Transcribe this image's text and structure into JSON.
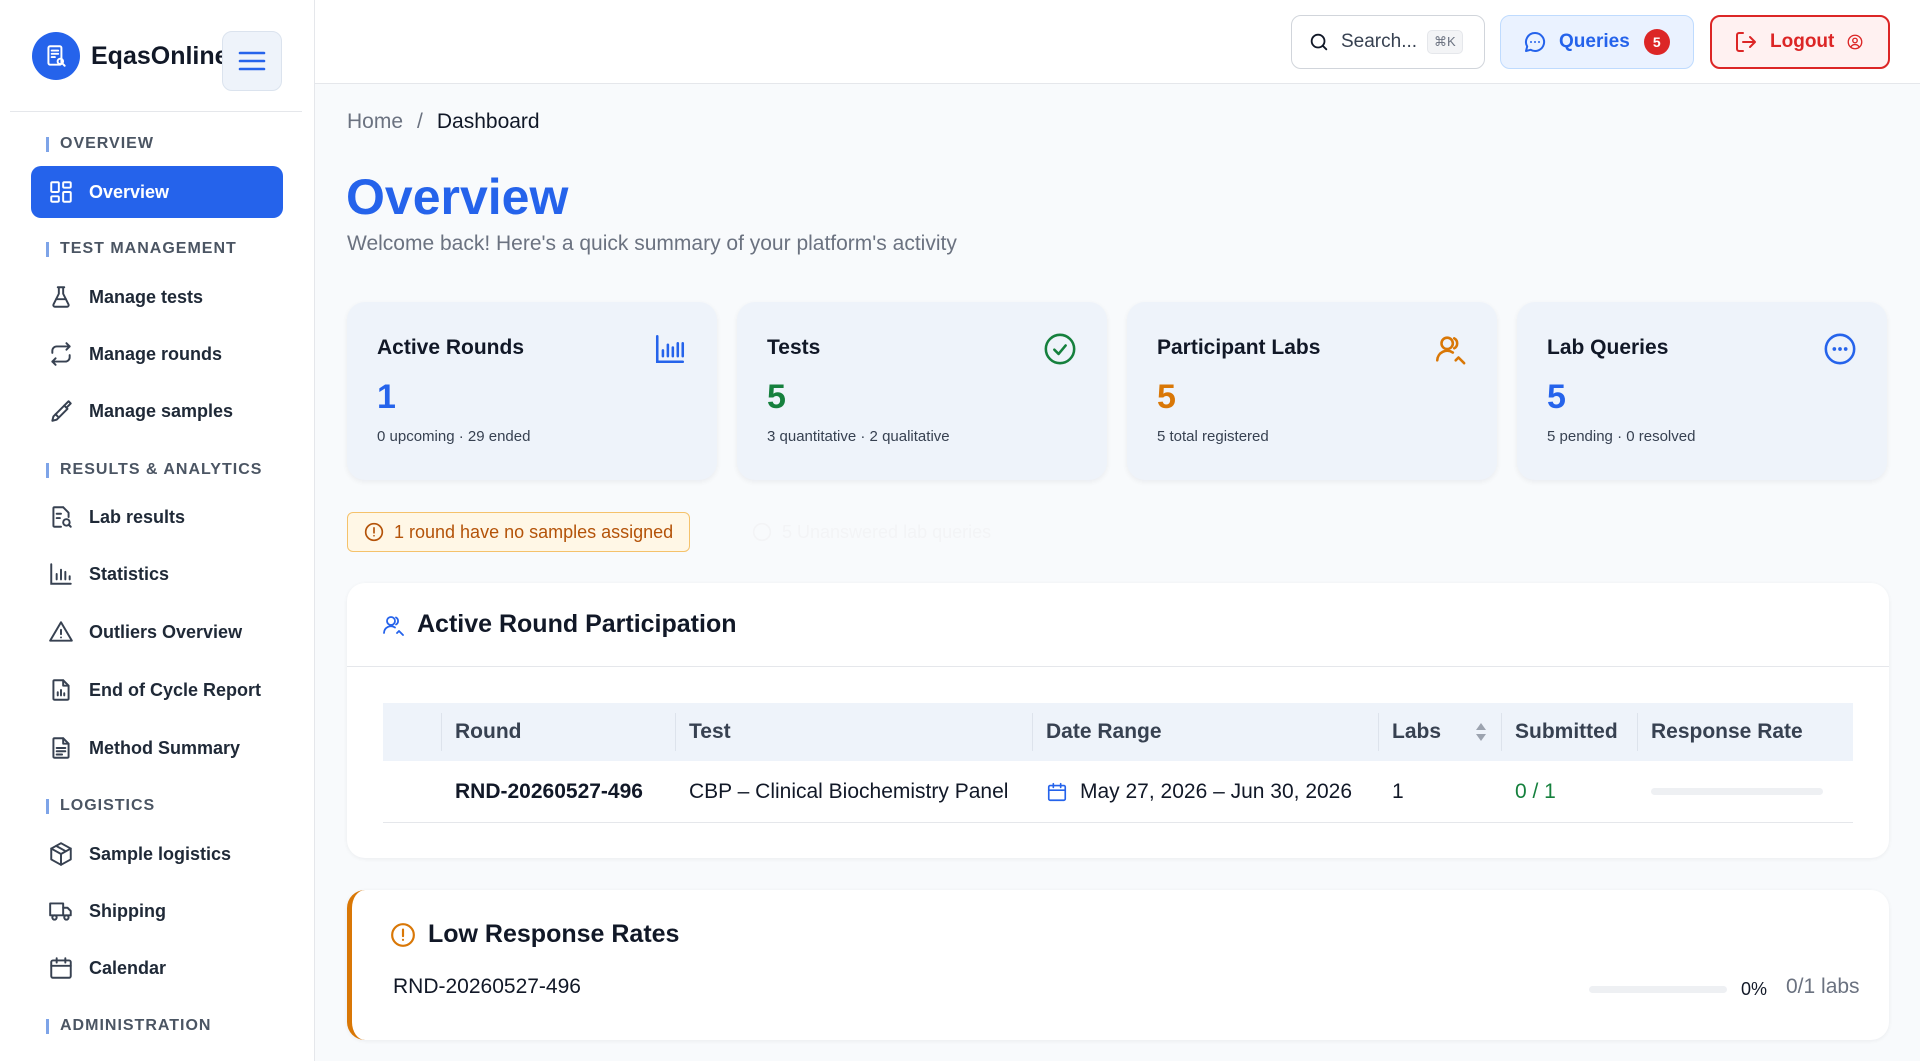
{
  "app": {
    "name": "EqasOnline"
  },
  "sidebar": {
    "sections": [
      {
        "label": "OVERVIEW"
      },
      {
        "label": "TEST MANAGEMENT"
      },
      {
        "label": "RESULTS & ANALYTICS"
      },
      {
        "label": "LOGISTICS"
      },
      {
        "label": "ADMINISTRATION"
      }
    ],
    "items": [
      {
        "label": "Overview",
        "icon": "grid-icon",
        "active": true
      },
      {
        "label": "Manage tests",
        "icon": "flask-icon"
      },
      {
        "label": "Manage rounds",
        "icon": "repeat-icon"
      },
      {
        "label": "Manage samples",
        "icon": "pipette-icon"
      },
      {
        "label": "Lab results",
        "icon": "file-chart-icon"
      },
      {
        "label": "Statistics",
        "icon": "bar-chart-icon"
      },
      {
        "label": "Outliers Overview",
        "icon": "warning-triangle-icon"
      },
      {
        "label": "End of Cycle Report",
        "icon": "report-icon"
      },
      {
        "label": "Method Summary",
        "icon": "document-icon"
      },
      {
        "label": "Sample logistics",
        "icon": "package-icon"
      },
      {
        "label": "Shipping",
        "icon": "truck-icon"
      },
      {
        "label": "Calendar",
        "icon": "calendar-icon"
      }
    ]
  },
  "topbar": {
    "search_label": "Search...",
    "search_shortcut": "⌘K",
    "queries_label": "Queries",
    "queries_count": "5",
    "logout_label": "Logout"
  },
  "breadcrumb": {
    "home": "Home",
    "separator": "/",
    "current": "Dashboard"
  },
  "page": {
    "title": "Overview",
    "subtitle": "Welcome back! Here's a quick summary of your platform's activity"
  },
  "stats": [
    {
      "title": "Active Rounds",
      "value": "1",
      "sub": "0 upcoming · 29 ended",
      "color": "#2563eb",
      "icon": "bar-chart-icon"
    },
    {
      "title": "Tests",
      "value": "5",
      "sub": "3 quantitative · 2 qualitative",
      "color": "#15803d",
      "icon": "check-circle-icon"
    },
    {
      "title": "Participant Labs",
      "value": "5",
      "sub": "5 total registered",
      "color": "#d97706",
      "icon": "users-icon"
    },
    {
      "title": "Lab Queries",
      "value": "5",
      "sub": "5 pending · 0 resolved",
      "color": "#2563eb",
      "icon": "chat-dots-icon"
    }
  ],
  "alerts": {
    "no_samples": "1 round have no samples assigned",
    "faded": "5 Unanswered lab queries"
  },
  "participation": {
    "title": "Active Round Participation",
    "columns": [
      "Round",
      "Test",
      "Date Range",
      "Labs",
      "Submitted",
      "Response Rate"
    ],
    "rows": [
      {
        "round": "RND-20260527-496",
        "test": "CBP – Clinical Biochemistry Panel",
        "date_range": "May 27, 2026 – Jun 30, 2026",
        "labs": "1",
        "submitted": "0 / 1",
        "response_rate": 0
      }
    ]
  },
  "low_response": {
    "title": "Low Response Rates",
    "round": "RND-20260527-496",
    "rate": 0,
    "percent_label": "0%",
    "labs_label": "0/1 labs"
  },
  "colors": {
    "accent": "#2563eb",
    "warning": "#d97706",
    "danger": "#dc2626",
    "success": "#15803d"
  }
}
